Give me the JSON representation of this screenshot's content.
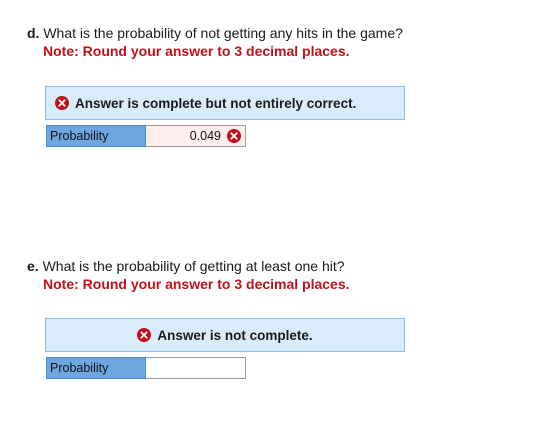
{
  "part_d": {
    "letter": "d.",
    "question": "What is the probability of not getting any hits in the game?",
    "note": "Note: Round your answer to 3 decimal places.",
    "banner_text": "Answer is complete but not entirely correct.",
    "banner_icon": "error-x-icon",
    "row_label": "Probability",
    "answer_value": "0.049",
    "answer_status": "incorrect"
  },
  "part_e": {
    "letter": "e.",
    "question": "What is the probability of getting at least one hit?",
    "note": "Note: Round your answer to 3 decimal places.",
    "banner_text": "Answer is not complete.",
    "banner_icon": "error-x-icon",
    "row_label": "Probability",
    "answer_value": ""
  },
  "colors": {
    "note_red": "#c0111a",
    "banner_bg": "#d9ecfb",
    "label_blue": "#6fa7e0",
    "error_red": "#c0111a"
  }
}
